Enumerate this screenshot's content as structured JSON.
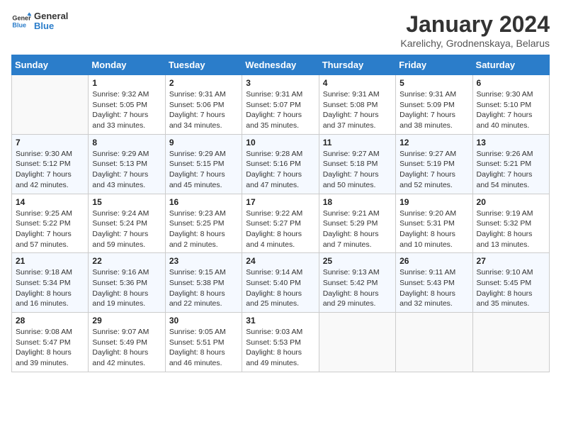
{
  "logo": {
    "text_general": "General",
    "text_blue": "Blue"
  },
  "title": "January 2024",
  "subtitle": "Karelichy, Grodnenskaya, Belarus",
  "weekdays": [
    "Sunday",
    "Monday",
    "Tuesday",
    "Wednesday",
    "Thursday",
    "Friday",
    "Saturday"
  ],
  "weeks": [
    [
      {
        "day": "",
        "sunrise": "",
        "sunset": "",
        "daylight": ""
      },
      {
        "day": "1",
        "sunrise": "9:32 AM",
        "sunset": "5:05 PM",
        "daylight": "7 hours and 33 minutes."
      },
      {
        "day": "2",
        "sunrise": "9:31 AM",
        "sunset": "5:06 PM",
        "daylight": "7 hours and 34 minutes."
      },
      {
        "day": "3",
        "sunrise": "9:31 AM",
        "sunset": "5:07 PM",
        "daylight": "7 hours and 35 minutes."
      },
      {
        "day": "4",
        "sunrise": "9:31 AM",
        "sunset": "5:08 PM",
        "daylight": "7 hours and 37 minutes."
      },
      {
        "day": "5",
        "sunrise": "9:31 AM",
        "sunset": "5:09 PM",
        "daylight": "7 hours and 38 minutes."
      },
      {
        "day": "6",
        "sunrise": "9:30 AM",
        "sunset": "5:10 PM",
        "daylight": "7 hours and 40 minutes."
      }
    ],
    [
      {
        "day": "7",
        "sunrise": "9:30 AM",
        "sunset": "5:12 PM",
        "daylight": "7 hours and 42 minutes."
      },
      {
        "day": "8",
        "sunrise": "9:29 AM",
        "sunset": "5:13 PM",
        "daylight": "7 hours and 43 minutes."
      },
      {
        "day": "9",
        "sunrise": "9:29 AM",
        "sunset": "5:15 PM",
        "daylight": "7 hours and 45 minutes."
      },
      {
        "day": "10",
        "sunrise": "9:28 AM",
        "sunset": "5:16 PM",
        "daylight": "7 hours and 47 minutes."
      },
      {
        "day": "11",
        "sunrise": "9:27 AM",
        "sunset": "5:18 PM",
        "daylight": "7 hours and 50 minutes."
      },
      {
        "day": "12",
        "sunrise": "9:27 AM",
        "sunset": "5:19 PM",
        "daylight": "7 hours and 52 minutes."
      },
      {
        "day": "13",
        "sunrise": "9:26 AM",
        "sunset": "5:21 PM",
        "daylight": "7 hours and 54 minutes."
      }
    ],
    [
      {
        "day": "14",
        "sunrise": "9:25 AM",
        "sunset": "5:22 PM",
        "daylight": "7 hours and 57 minutes."
      },
      {
        "day": "15",
        "sunrise": "9:24 AM",
        "sunset": "5:24 PM",
        "daylight": "7 hours and 59 minutes."
      },
      {
        "day": "16",
        "sunrise": "9:23 AM",
        "sunset": "5:25 PM",
        "daylight": "8 hours and 2 minutes."
      },
      {
        "day": "17",
        "sunrise": "9:22 AM",
        "sunset": "5:27 PM",
        "daylight": "8 hours and 4 minutes."
      },
      {
        "day": "18",
        "sunrise": "9:21 AM",
        "sunset": "5:29 PM",
        "daylight": "8 hours and 7 minutes."
      },
      {
        "day": "19",
        "sunrise": "9:20 AM",
        "sunset": "5:31 PM",
        "daylight": "8 hours and 10 minutes."
      },
      {
        "day": "20",
        "sunrise": "9:19 AM",
        "sunset": "5:32 PM",
        "daylight": "8 hours and 13 minutes."
      }
    ],
    [
      {
        "day": "21",
        "sunrise": "9:18 AM",
        "sunset": "5:34 PM",
        "daylight": "8 hours and 16 minutes."
      },
      {
        "day": "22",
        "sunrise": "9:16 AM",
        "sunset": "5:36 PM",
        "daylight": "8 hours and 19 minutes."
      },
      {
        "day": "23",
        "sunrise": "9:15 AM",
        "sunset": "5:38 PM",
        "daylight": "8 hours and 22 minutes."
      },
      {
        "day": "24",
        "sunrise": "9:14 AM",
        "sunset": "5:40 PM",
        "daylight": "8 hours and 25 minutes."
      },
      {
        "day": "25",
        "sunrise": "9:13 AM",
        "sunset": "5:42 PM",
        "daylight": "8 hours and 29 minutes."
      },
      {
        "day": "26",
        "sunrise": "9:11 AM",
        "sunset": "5:43 PM",
        "daylight": "8 hours and 32 minutes."
      },
      {
        "day": "27",
        "sunrise": "9:10 AM",
        "sunset": "5:45 PM",
        "daylight": "8 hours and 35 minutes."
      }
    ],
    [
      {
        "day": "28",
        "sunrise": "9:08 AM",
        "sunset": "5:47 PM",
        "daylight": "8 hours and 39 minutes."
      },
      {
        "day": "29",
        "sunrise": "9:07 AM",
        "sunset": "5:49 PM",
        "daylight": "8 hours and 42 minutes."
      },
      {
        "day": "30",
        "sunrise": "9:05 AM",
        "sunset": "5:51 PM",
        "daylight": "8 hours and 46 minutes."
      },
      {
        "day": "31",
        "sunrise": "9:03 AM",
        "sunset": "5:53 PM",
        "daylight": "8 hours and 49 minutes."
      },
      {
        "day": "",
        "sunrise": "",
        "sunset": "",
        "daylight": ""
      },
      {
        "day": "",
        "sunrise": "",
        "sunset": "",
        "daylight": ""
      },
      {
        "day": "",
        "sunrise": "",
        "sunset": "",
        "daylight": ""
      }
    ]
  ],
  "labels": {
    "sunrise": "Sunrise:",
    "sunset": "Sunset:",
    "daylight": "Daylight:"
  }
}
